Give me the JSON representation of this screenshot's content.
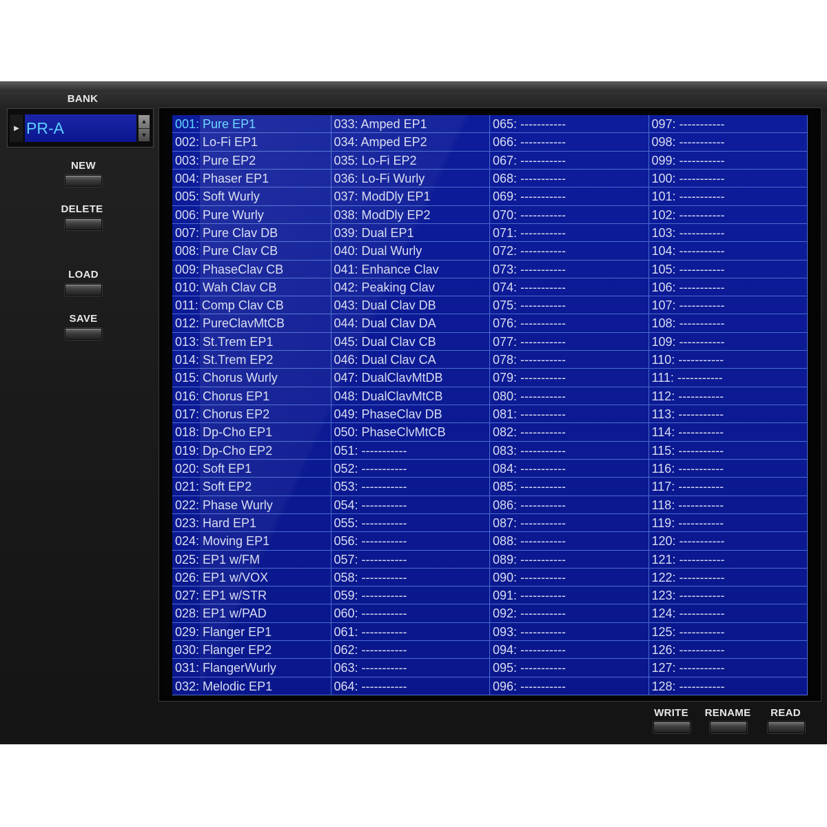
{
  "bank": {
    "label": "BANK",
    "value": "PR-A"
  },
  "left_buttons": {
    "new": "NEW",
    "delete": "DELETE",
    "load": "LOAD",
    "save": "SAVE"
  },
  "bottom_buttons": {
    "write": "WRITE",
    "rename": "RENAME",
    "read": "READ"
  },
  "selected_patch": "001",
  "patches": [
    "001: Pure EP1",
    "002: Lo-Fi EP1",
    "003: Pure EP2",
    "004: Phaser EP1",
    "005: Soft Wurly",
    "006: Pure Wurly",
    "007: Pure Clav DB",
    "008: Pure Clav CB",
    "009: PhaseClav CB",
    "010: Wah Clav CB",
    "011: Comp Clav CB",
    "012: PureClavMtCB",
    "013: St.Trem EP1",
    "014: St.Trem EP2",
    "015: Chorus Wurly",
    "016: Chorus EP1",
    "017: Chorus EP2",
    "018: Dp-Cho EP1",
    "019: Dp-Cho EP2",
    "020: Soft EP1",
    "021: Soft EP2",
    "022: Phase Wurly",
    "023: Hard EP1",
    "024: Moving EP1",
    "025: EP1 w/FM",
    "026: EP1 w/VOX",
    "027: EP1 w/STR",
    "028: EP1 w/PAD",
    "029: Flanger EP1",
    "030: Flanger EP2",
    "031: FlangerWurly",
    "032: Melodic EP1",
    "033: Amped EP1",
    "034: Amped EP2",
    "035: Lo-Fi EP2",
    "036: Lo-Fi Wurly",
    "037: ModDly EP1",
    "038: ModDly EP2",
    "039: Dual EP1",
    "040: Dual Wurly",
    "041: Enhance Clav",
    "042: Peaking Clav",
    "043: Dual Clav DB",
    "044: Dual Clav DA",
    "045: Dual Clav CB",
    "046: Dual Clav CA",
    "047: DualClavMtDB",
    "048: DualClavMtCB",
    "049: PhaseClav DB",
    "050: PhaseClvMtCB",
    "051: -----------",
    "052: -----------",
    "053: -----------",
    "054: -----------",
    "055: -----------",
    "056: -----------",
    "057: -----------",
    "058: -----------",
    "059: -----------",
    "060: -----------",
    "061: -----------",
    "062: -----------",
    "063: -----------",
    "064: -----------",
    "065: -----------",
    "066: -----------",
    "067: -----------",
    "068: -----------",
    "069: -----------",
    "070: -----------",
    "071: -----------",
    "072: -----------",
    "073: -----------",
    "074: -----------",
    "075: -----------",
    "076: -----------",
    "077: -----------",
    "078: -----------",
    "079: -----------",
    "080: -----------",
    "081: -----------",
    "082: -----------",
    "083: -----------",
    "084: -----------",
    "085: -----------",
    "086: -----------",
    "087: -----------",
    "088: -----------",
    "089: -----------",
    "090: -----------",
    "091: -----------",
    "092: -----------",
    "093: -----------",
    "094: -----------",
    "095: -----------",
    "096: -----------",
    "097: -----------",
    "098: -----------",
    "099: -----------",
    "100: -----------",
    "101: -----------",
    "102: -----------",
    "103: -----------",
    "104: -----------",
    "105: -----------",
    "106: -----------",
    "107: -----------",
    "108: -----------",
    "109: -----------",
    "110: -----------",
    "111: -----------",
    "112: -----------",
    "113: -----------",
    "114: -----------",
    "115: -----------",
    "116: -----------",
    "117: -----------",
    "118: -----------",
    "119: -----------",
    "120: -----------",
    "121: -----------",
    "122: -----------",
    "123: -----------",
    "124: -----------",
    "125: -----------",
    "126: -----------",
    "127: -----------",
    "128: -----------"
  ],
  "colors": {
    "list_bg": "#0a1890",
    "grid_line": "#4b6dd1",
    "text": "#d8dcf0",
    "selected_text": "#62d4ff"
  }
}
